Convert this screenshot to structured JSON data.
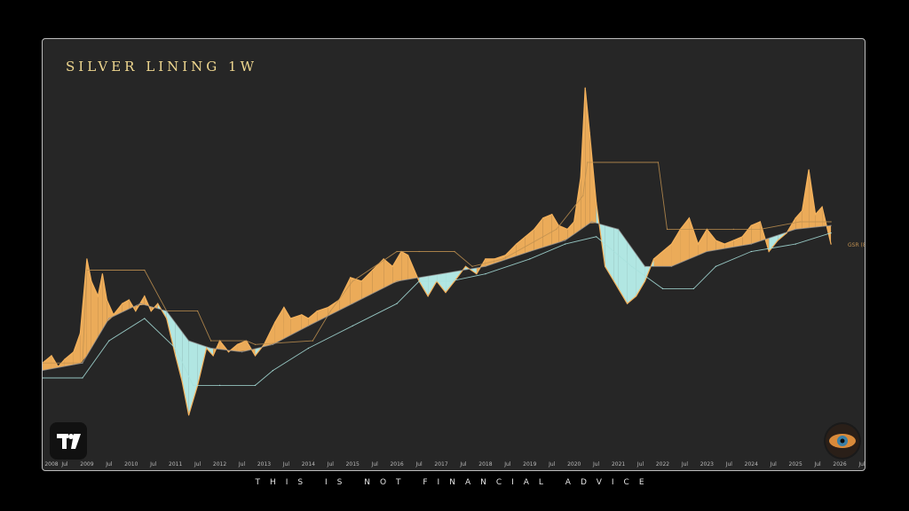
{
  "title": "SILVER LINING  1W",
  "footer": "THIS IS NOT FINANCIAL ADVICE",
  "price_label": "GSR (8",
  "chart_data": {
    "type": "area",
    "title": "SILVER LINING  1W",
    "x_ticks": [
      "2008",
      "Jul",
      "2009",
      "Jul",
      "2010",
      "Jul",
      "2011",
      "Jul",
      "2012",
      "Jul",
      "2013",
      "Jul",
      "2014",
      "Jul",
      "2015",
      "Jul",
      "2016",
      "Jul",
      "2017",
      "Jul",
      "2018",
      "Jul",
      "2019",
      "Jul",
      "2020",
      "Jul",
      "2021",
      "Jul",
      "2022",
      "Jul",
      "2023",
      "Jul",
      "2024",
      "Jul",
      "2025",
      "Jul",
      "2026",
      "Jul"
    ],
    "x_range": [
      2008.0,
      2026.6
    ],
    "price_line_label": "GSR (8",
    "series": [
      {
        "name": "",
        "color": "#f5b25c",
        "points": [
          [
            2008.0,
            50
          ],
          [
            2008.2,
            52
          ],
          [
            2008.35,
            49
          ],
          [
            2008.5,
            51
          ],
          [
            2008.7,
            53
          ],
          [
            2008.85,
            58
          ],
          [
            2009.0,
            78
          ],
          [
            2009.1,
            72
          ],
          [
            2009.25,
            68
          ],
          [
            2009.35,
            74
          ],
          [
            2009.45,
            67
          ],
          [
            2009.6,
            63
          ],
          [
            2009.8,
            66
          ],
          [
            2009.95,
            67
          ],
          [
            2010.1,
            64
          ],
          [
            2010.3,
            68
          ],
          [
            2010.45,
            64
          ],
          [
            2010.6,
            66
          ],
          [
            2010.8,
            62
          ],
          [
            2011.0,
            52
          ],
          [
            2011.15,
            45
          ],
          [
            2011.3,
            36
          ],
          [
            2011.5,
            44
          ],
          [
            2011.7,
            54
          ],
          [
            2011.85,
            52
          ],
          [
            2012.0,
            56
          ],
          [
            2012.2,
            53
          ],
          [
            2012.4,
            55
          ],
          [
            2012.6,
            56
          ],
          [
            2012.8,
            52
          ],
          [
            2013.0,
            55
          ],
          [
            2013.25,
            61
          ],
          [
            2013.45,
            65
          ],
          [
            2013.6,
            62
          ],
          [
            2013.85,
            63
          ],
          [
            2014.0,
            62
          ],
          [
            2014.2,
            64
          ],
          [
            2014.45,
            65
          ],
          [
            2014.7,
            67
          ],
          [
            2014.95,
            73
          ],
          [
            2015.2,
            72
          ],
          [
            2015.45,
            75
          ],
          [
            2015.7,
            78
          ],
          [
            2015.9,
            76
          ],
          [
            2016.1,
            80
          ],
          [
            2016.25,
            79
          ],
          [
            2016.5,
            72
          ],
          [
            2016.7,
            68
          ],
          [
            2016.9,
            72
          ],
          [
            2017.1,
            69
          ],
          [
            2017.3,
            72
          ],
          [
            2017.55,
            76
          ],
          [
            2017.8,
            74
          ],
          [
            2018.0,
            78
          ],
          [
            2018.2,
            78
          ],
          [
            2018.45,
            79
          ],
          [
            2018.7,
            82
          ],
          [
            2018.9,
            84
          ],
          [
            2019.1,
            86
          ],
          [
            2019.3,
            89
          ],
          [
            2019.5,
            90
          ],
          [
            2019.65,
            87
          ],
          [
            2019.85,
            86
          ],
          [
            2020.0,
            88
          ],
          [
            2020.15,
            100
          ],
          [
            2020.25,
            124
          ],
          [
            2020.35,
            112
          ],
          [
            2020.5,
            93
          ],
          [
            2020.7,
            76
          ],
          [
            2020.9,
            72
          ],
          [
            2021.0,
            70
          ],
          [
            2021.2,
            66
          ],
          [
            2021.4,
            68
          ],
          [
            2021.6,
            72
          ],
          [
            2021.8,
            78
          ],
          [
            2022.0,
            80
          ],
          [
            2022.2,
            82
          ],
          [
            2022.4,
            86
          ],
          [
            2022.6,
            89
          ],
          [
            2022.8,
            82
          ],
          [
            2023.0,
            86
          ],
          [
            2023.2,
            83
          ],
          [
            2023.4,
            82
          ],
          [
            2023.6,
            83
          ],
          [
            2023.8,
            84
          ],
          [
            2024.0,
            87
          ],
          [
            2024.2,
            88
          ],
          [
            2024.4,
            80
          ],
          [
            2024.6,
            83
          ],
          [
            2024.8,
            85
          ],
          [
            2025.0,
            89
          ],
          [
            2025.15,
            91
          ],
          [
            2025.3,
            102
          ],
          [
            2025.45,
            90
          ],
          [
            2025.6,
            92
          ],
          [
            2025.8,
            82
          ]
        ]
      },
      {
        "name": "",
        "color": "#c09050",
        "points": [
          [
            2008.0,
            50
          ],
          [
            2008.9,
            50
          ],
          [
            2009.0,
            75
          ],
          [
            2010.3,
            75
          ],
          [
            2010.8,
            64
          ],
          [
            2011.5,
            64
          ],
          [
            2011.8,
            56
          ],
          [
            2012.6,
            56
          ],
          [
            2012.8,
            55
          ],
          [
            2014.1,
            56
          ],
          [
            2014.5,
            64
          ],
          [
            2015.0,
            72
          ],
          [
            2016.0,
            80
          ],
          [
            2016.5,
            80
          ],
          [
            2017.3,
            80
          ],
          [
            2017.7,
            76
          ],
          [
            2018.4,
            78
          ],
          [
            2019.6,
            86
          ],
          [
            2020.2,
            95
          ],
          [
            2020.3,
            104
          ],
          [
            2021.9,
            104
          ],
          [
            2022.1,
            86
          ],
          [
            2023.6,
            86
          ],
          [
            2024.2,
            86
          ],
          [
            2025.1,
            88
          ],
          [
            2025.8,
            88
          ]
        ]
      },
      {
        "name": "",
        "color": "#8e8e8e",
        "points": [
          [
            2008.0,
            48
          ],
          [
            2008.9,
            50
          ],
          [
            2009.5,
            62
          ],
          [
            2010.2,
            66
          ],
          [
            2010.8,
            64
          ],
          [
            2011.3,
            56
          ],
          [
            2011.8,
            54
          ],
          [
            2012.5,
            53
          ],
          [
            2013.2,
            55
          ],
          [
            2014.0,
            60
          ],
          [
            2015.0,
            66
          ],
          [
            2016.0,
            72
          ],
          [
            2017.0,
            74
          ],
          [
            2018.0,
            76
          ],
          [
            2019.0,
            80
          ],
          [
            2019.8,
            83
          ],
          [
            2020.4,
            88
          ],
          [
            2021.0,
            86
          ],
          [
            2021.6,
            76
          ],
          [
            2022.2,
            76
          ],
          [
            2023.0,
            80
          ],
          [
            2024.0,
            82
          ],
          [
            2025.0,
            86
          ],
          [
            2025.8,
            87
          ]
        ]
      },
      {
        "name": "",
        "color": "#a8e0dc",
        "points": [
          [
            2008.0,
            46
          ],
          [
            2008.9,
            46
          ],
          [
            2009.5,
            56
          ],
          [
            2010.3,
            62
          ],
          [
            2011.0,
            54
          ],
          [
            2011.4,
            44
          ],
          [
            2012.0,
            44
          ],
          [
            2012.8,
            44
          ],
          [
            2013.2,
            48
          ],
          [
            2014.0,
            54
          ],
          [
            2015.0,
            60
          ],
          [
            2016.0,
            66
          ],
          [
            2016.5,
            72
          ],
          [
            2017.2,
            72
          ],
          [
            2018.0,
            74
          ],
          [
            2019.0,
            78
          ],
          [
            2019.8,
            82
          ],
          [
            2020.5,
            84
          ],
          [
            2021.3,
            76
          ],
          [
            2022.0,
            70
          ],
          [
            2022.7,
            70
          ],
          [
            2023.2,
            76
          ],
          [
            2024.0,
            80
          ],
          [
            2025.0,
            82
          ],
          [
            2025.8,
            85
          ]
        ]
      }
    ],
    "grid": false,
    "legend": "none"
  }
}
